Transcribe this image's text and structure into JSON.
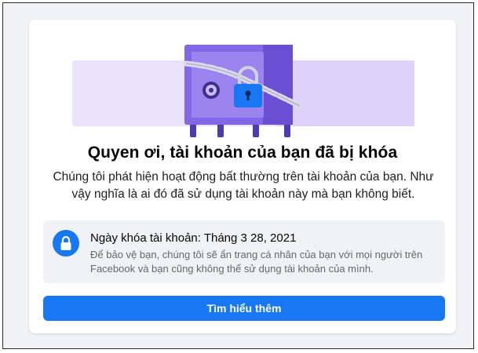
{
  "card": {
    "title": "Quyen ơi, tài khoản của bạn đã bị khóa",
    "description": "Chúng tôi phát hiện hoạt động bất thường trên tài khoản của bạn. Như vậy nghĩa là ai đó đã sử dụng tài khoản này mà bạn không biết."
  },
  "info": {
    "icon": "lock-icon",
    "title": "Ngày khóa tài khoản: Tháng 3 28, 2021",
    "text": "Để bảo vệ bạn, chúng tôi sẽ ẩn trang cá nhân của bạn với mọi người trên Facebook và bạn cũng không thể sử dụng tài khoản của mình."
  },
  "actions": {
    "learn_more_label": "Tìm hiểu thêm"
  },
  "colors": {
    "accent": "#1877f2",
    "illustration_purple": "#7b5ce0",
    "illustration_light": "#e4dcfb"
  }
}
